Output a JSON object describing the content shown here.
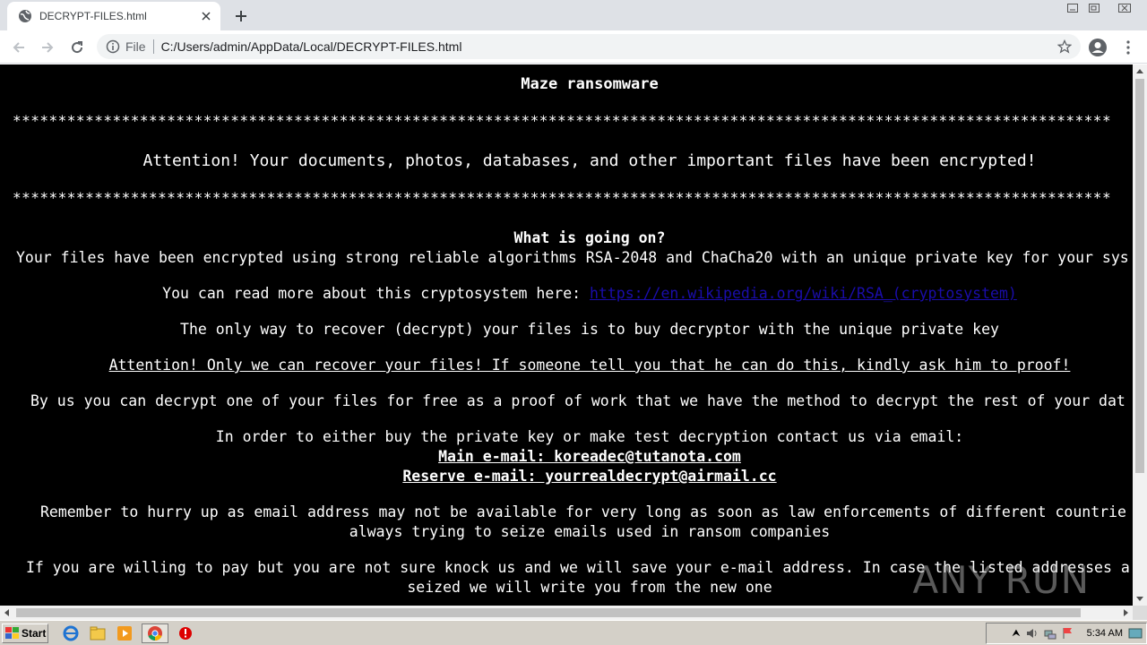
{
  "browser": {
    "tab_title": "DECRYPT-FILES.html",
    "scheme_label": "File",
    "url": "C:/Users/admin/AppData/Local/DECRYPT-FILES.html"
  },
  "note": {
    "title": "Maze ransomware",
    "stars": "*************************************************************************************************************************",
    "headline": "Attention! Your documents, photos, databases, and other important files have been encrypted!",
    "what_heading": "What is going on?",
    "line1": "Your files have been encrypted using strong reliable algorithms RSA-2048 and ChaCha20 with an unique private key for your sys",
    "read_more_prefix": "You can read more about this cryptosystem here: ",
    "read_more_link": "https://en.wikipedia.org/wiki/RSA_(cryptosystem)",
    "only_way": "The only way to recover (decrypt) your files is to buy decryptor with the unique private key",
    "attention_only": "Attention! Only we can recover your files! If someone tell you that he can do this, kindly ask him to proof!",
    "by_us": "By us you can decrypt one of your files for free as a proof of work that we have the method to decrypt the rest of your dat",
    "contact": "In order to either buy the private key or make test decryption contact us via email:",
    "main_email": "Main e-mail: koreadec@tutanota.com",
    "reserve_email": "Reserve e-mail: yourrealdecrypt@airmail.cc",
    "remember_1": "Remember to hurry up as email address may not be available for very long as soon as law enforcements of different countrie",
    "remember_2": "always trying to seize emails used in ransom companies",
    "willing_1": "If you are willing to pay but you are not sure knock us and we will save your e-mail address. In case the listed addresses a",
    "willing_2": "seized we will write you from the new one"
  },
  "watermark": "ANY RUN",
  "taskbar": {
    "start_label": "Start",
    "clock": "5:34 AM"
  },
  "colors": {
    "page_bg": "#000000",
    "page_text": "#ffffff",
    "link": "#1a0dab"
  }
}
